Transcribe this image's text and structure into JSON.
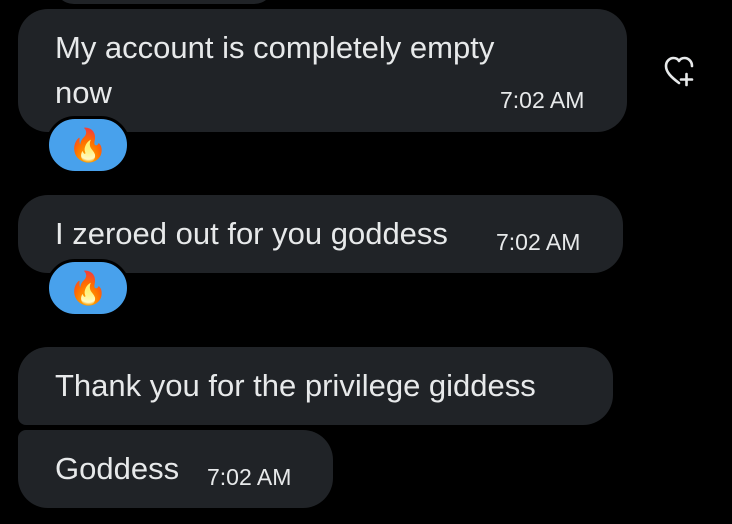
{
  "messages": [
    {
      "line1": "My account is completely empty",
      "line2": "now",
      "time": "7:02 AM",
      "reaction": "🔥"
    },
    {
      "text": "I zeroed out for you goddess",
      "time": "7:02 AM",
      "reaction": "🔥"
    },
    {
      "text": "Thank you for the privilege giddess"
    },
    {
      "text": "Goddess",
      "time": "7:02 AM"
    }
  ],
  "actions": {
    "add_reaction_icon": "heart-plus-icon"
  },
  "colors": {
    "background": "#000000",
    "bubble": "#202327",
    "text": "#e7e9ea",
    "reaction_pill": "#48a1ec"
  }
}
